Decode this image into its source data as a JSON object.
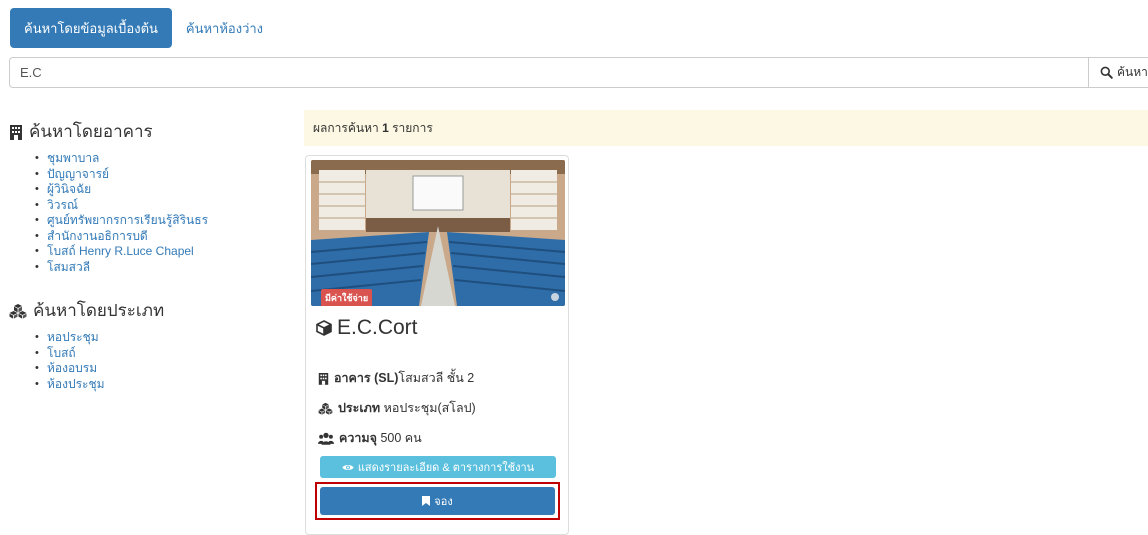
{
  "tabs": [
    {
      "label": "ค้นหาโดยข้อมูลเบื้องต้น",
      "active": true
    },
    {
      "label": "ค้นหาห้องว่าง",
      "active": false
    }
  ],
  "search": {
    "value": "E.C",
    "button_label": "ค้นหา",
    "icon": "search-icon"
  },
  "sidebar": {
    "buildings_heading": "ค้นหาโดยอาคาร",
    "buildings": [
      "ชุมพาบาล",
      "ปัญญาจารย์",
      "ผู้วินิจฉัย",
      "วิวรณ์",
      "ศูนย์ทรัพยากรการเรียนรู้สิรินธร",
      "สำนักงานอธิการบดี",
      "โบสถ์ Henry R.Luce Chapel",
      "โสมสวลี"
    ],
    "types_heading": "ค้นหาโดยประเภท",
    "types": [
      "หอประชุม",
      "โบสถ์",
      "ห้องอบรม",
      "ห้องประชุม"
    ]
  },
  "results": {
    "prefix": "ผลการค้นหา",
    "count": "1",
    "suffix": "รายการ"
  },
  "card": {
    "badge": "มีค่าใช้จ่าย",
    "title": "E.C.Cort",
    "building_label": "อาคาร",
    "building_code": "(SL)",
    "building_value": "โสมสวลี ชั้น 2",
    "type_label": "ประเภท",
    "type_value": "หอประชุม(สโลป)",
    "capacity_label": "ความจุ",
    "capacity_value": "500 คน",
    "detail_button": "แสดงรายละเอียด & ตารางการใช้งาน",
    "book_button": "จอง"
  },
  "colors": {
    "primary": "#337ab7",
    "info": "#5bc0de",
    "danger": "#d9534f",
    "highlight": "#c00000",
    "result_bg": "#fcf8e3"
  }
}
